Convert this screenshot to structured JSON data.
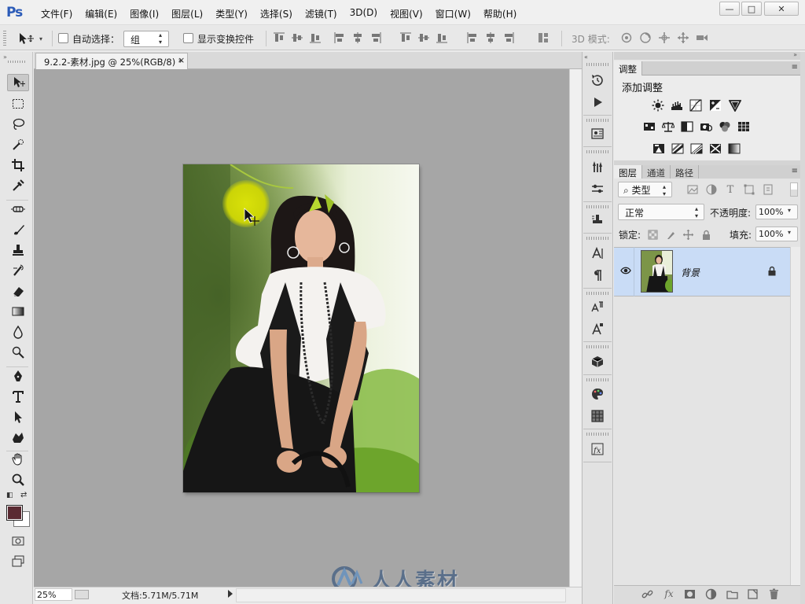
{
  "app": {
    "logo": "Ps",
    "menu": [
      "文件(F)",
      "编辑(E)",
      "图像(I)",
      "图层(L)",
      "类型(Y)",
      "选择(S)",
      "滤镜(T)",
      "3D(D)",
      "视图(V)",
      "窗口(W)",
      "帮助(H)"
    ]
  },
  "window_controls": {
    "minimize": "—",
    "maximize": "□",
    "close": "✕"
  },
  "options_bar": {
    "auto_select_label": "自动选择：",
    "auto_select_value": "组",
    "show_transform_label": "显示变换控件",
    "mode_3d_label": "3D 模式:",
    "auto_select_checked": false,
    "show_transform_checked": false
  },
  "document": {
    "tab_title": "9.2.2-素材.jpg @ 25%(RGB/8) *",
    "tab_close": "×",
    "zoom": "25%",
    "doc_info": "文档:5.71M/5.71M"
  },
  "panels": {
    "adjustments": {
      "tab": "调整",
      "title": "添加调整",
      "icons": [
        [
          "brightness-contrast-icon",
          "levels-icon",
          "curves-icon",
          "exposure-icon",
          "vibrance-icon"
        ],
        [
          "hue-saturation-icon",
          "color-balance-icon",
          "black-white-icon",
          "photo-filter-icon",
          "channel-mixer-icon",
          "color-lookup-icon"
        ],
        [
          "invert-icon",
          "posterize-icon",
          "threshold-icon",
          "selective-color-icon",
          "gradient-map-icon"
        ]
      ]
    },
    "layers": {
      "tabs": [
        "图层",
        "通道",
        "路径"
      ],
      "active_tab": "图层",
      "filter_label": "类型",
      "blend_mode": "正常",
      "opacity_label": "不透明度:",
      "opacity_value": "100%",
      "lock_label": "锁定:",
      "fill_label": "填充:",
      "fill_value": "100%",
      "items": [
        {
          "name": "背景",
          "visible": true,
          "locked": true,
          "selected": true
        }
      ]
    }
  },
  "watermark": {
    "text": "人人素材"
  },
  "colors": {
    "foreground": "#5a2a32",
    "background": "#ffffff",
    "canvas_bg": "#a6a6a6",
    "layer_selected": "#c9dcf6",
    "ps_blue": "#2b5bb8"
  }
}
